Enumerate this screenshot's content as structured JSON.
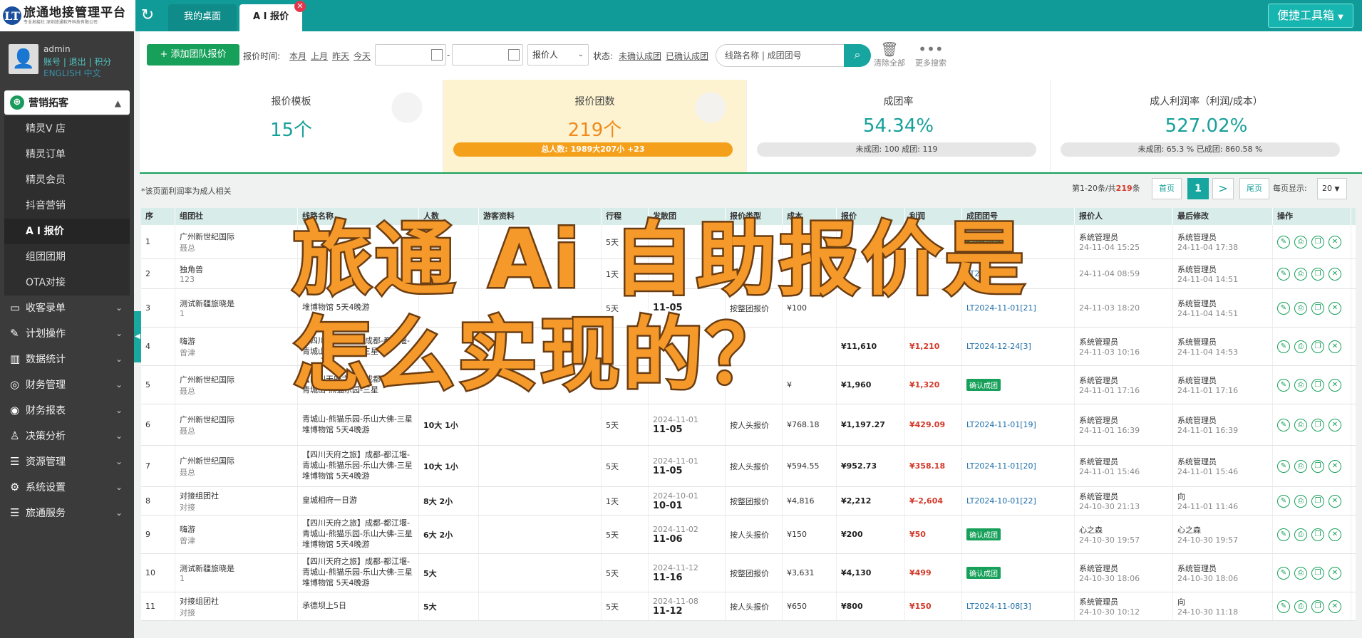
{
  "topbar": {
    "logo_letter": "LT",
    "logo_title": "旅通地接管理平台",
    "logo_sub": "专业地接社 深圳旅通软件科技有限公司",
    "tab_desktop": "我的桌面",
    "tab_ai": "A I 报价",
    "toolbox": "便捷工具箱"
  },
  "user": {
    "name": "admin",
    "links": "账号 | 退出 | 积分",
    "lang": "ENGLISH  中文"
  },
  "sidebar": {
    "section": "营销拓客",
    "subitems": [
      "精灵V 店",
      "精灵订单",
      "精灵会员",
      "抖音营销",
      "A I 报价",
      "组团团期",
      "OTA对接"
    ],
    "items": [
      {
        "label": "收客录单",
        "icon": "monitor-icon"
      },
      {
        "label": "计划操作",
        "icon": "edit-icon"
      },
      {
        "label": "数据统计",
        "icon": "chart-icon"
      },
      {
        "label": "财务管理",
        "icon": "coins-icon"
      },
      {
        "label": "财务报表",
        "icon": "moneybag-icon"
      },
      {
        "label": "决策分析",
        "icon": "user-plus-icon"
      },
      {
        "label": "资源管理",
        "icon": "list-icon"
      },
      {
        "label": "系统设置",
        "icon": "gear-icon"
      },
      {
        "label": "旅通服务",
        "icon": "list-icon"
      }
    ]
  },
  "filters": {
    "add_button": "添加团队报价",
    "time_label": "报价时间:",
    "quick": [
      "本月",
      "上月",
      "昨天",
      "今天"
    ],
    "dash": "-",
    "quoter": "报价人",
    "status_label": "状态:",
    "status_unconfirmed": "未确认成团",
    "status_confirmed": "已确认成团",
    "search_placeholder": "线路名称 | 成团团号",
    "clear_all": "清除全部",
    "more_search": "更多搜索"
  },
  "stats": [
    {
      "title": "报价模板",
      "value": "15个",
      "bar": ""
    },
    {
      "title": "报价团数",
      "value": "219个",
      "bar": "总人数:  1989大207小 +23"
    },
    {
      "title": "成团率",
      "value": "54.34%",
      "bar": "未成团: 100  成团: 119"
    },
    {
      "title": "成人利润率（利润/成本）",
      "value": "527.02%",
      "bar": "未成团: 65.3 %  已成团: 860.58 %"
    }
  ],
  "note": "*该页面利润率为成人相关",
  "pager": {
    "summary_pre": "第1-20条/共",
    "total": "219",
    "summary_post": "条",
    "first": "首页",
    "current": "1",
    "next": ">",
    "last": "尾页",
    "per_page_label": "每页显示:",
    "per_page": "20"
  },
  "columns": [
    "序",
    "组团社",
    "线路名称",
    "人数",
    "游客资料",
    "行程",
    "发散团",
    "报价类型",
    "成本",
    "报价",
    "利润",
    "成团团号",
    "报价人",
    "最后修改",
    "操作"
  ],
  "rows": [
    {
      "no": "1",
      "agency": "广州新世纪国际",
      "contact": "聂总",
      "route": "",
      "people": "",
      "days": "5天",
      "d1": "",
      "d2": "",
      "qtype": "",
      "cost": "",
      "price": "",
      "profit": "",
      "group_no": "",
      "badge": "确认成团",
      "quoter": "系统管理员",
      "qtime": "24-11-04 15:25",
      "editor": "系统管理员",
      "etime": "24-11-04 17:38"
    },
    {
      "no": "2",
      "agency": "独角兽",
      "contact": "123",
      "route": "",
      "people": "",
      "days": "1天",
      "d1": "",
      "d2": "",
      "qtype": "",
      "cost": "",
      "price": "",
      "profit": "",
      "group_no": "LT2024-1",
      "badge": "",
      "quoter": "",
      "qtime": "24-11-04 08:59",
      "editor": "系统管理员",
      "etime": "24-11-04 14:51"
    },
    {
      "no": "3",
      "agency": "测试新疆旅晓是",
      "contact": "1",
      "route": "堆博物馆 5天4晚游",
      "people": "",
      "days": "5天",
      "d1": "",
      "d2": "11-05",
      "qtype": "按整团报价",
      "cost": "¥100",
      "price": "",
      "profit": "",
      "group_no": "LT2024-11-01[21]",
      "badge": "",
      "quoter": "",
      "qtime": "24-11-03 18:20",
      "editor": "系统管理员",
      "etime": "24-11-04 14:51"
    },
    {
      "no": "4",
      "agency": "嗨游",
      "contact": "曾津",
      "route": "【四川天府之旅】成都-都江堰-青城山-熊猫乐园-三星",
      "people": "",
      "days": "",
      "d1": "",
      "d2": "",
      "qtype": "",
      "cost": "",
      "price": "¥11,610",
      "profit": "¥1,210",
      "group_no": "LT2024-12-24[3]",
      "badge": "",
      "quoter": "系统管理员",
      "qtime": "24-11-03 10:16",
      "editor": "系统管理员",
      "etime": "24-11-04 14:53"
    },
    {
      "no": "5",
      "agency": "广州新世纪国际",
      "contact": "聂总",
      "route": "【四川天府之旅】成都-都江堰-青城山-熊猫乐园-三星",
      "people": "",
      "days": "",
      "d1": "",
      "d2": "",
      "qtype": "",
      "cost": "¥",
      "price": "¥1,960",
      "profit": "¥1,320",
      "group_no": "",
      "badge": "确认成团",
      "quoter": "系统管理员",
      "qtime": "24-11-01 17:16",
      "editor": "系统管理员",
      "etime": "24-11-01 17:16"
    },
    {
      "no": "6",
      "agency": "广州新世纪国际",
      "contact": "聂总",
      "route": "青城山-熊猫乐园-乐山大佛-三星堆博物馆 5天4晚游",
      "people": "10大 1小",
      "days": "5天",
      "d1": "2024-11-01",
      "d2": "11-05",
      "qtype": "按人头报价",
      "cost": "¥768.18",
      "price": "¥1,197.27",
      "profit": "¥429.09",
      "group_no": "LT2024-11-01[19]",
      "badge": "",
      "quoter": "系统管理员",
      "qtime": "24-11-01 16:39",
      "editor": "系统管理员",
      "etime": "24-11-01 16:39"
    },
    {
      "no": "7",
      "agency": "广州新世纪国际",
      "contact": "聂总",
      "route": "【四川天府之旅】成都-都江堰-青城山-熊猫乐园-乐山大佛-三星堆博物馆 5天4晚游",
      "people": "10大 1小",
      "days": "5天",
      "d1": "2024-11-01",
      "d2": "11-05",
      "qtype": "按人头报价",
      "cost": "¥594.55",
      "price": "¥952.73",
      "profit": "¥358.18",
      "group_no": "LT2024-11-01[20]",
      "badge": "",
      "quoter": "系统管理员",
      "qtime": "24-11-01 15:46",
      "editor": "系统管理员",
      "etime": "24-11-01 15:46"
    },
    {
      "no": "8",
      "agency": "对接组团社",
      "contact": "对接",
      "route": "皇城相府一日游",
      "people": "8大 2小",
      "days": "1天",
      "d1": "2024-10-01",
      "d2": "10-01",
      "qtype": "按整团报价",
      "cost": "¥4,816",
      "price": "¥2,212",
      "profit": "¥-2,604",
      "group_no": "LT2024-10-01[22]",
      "badge": "",
      "quoter": "系统管理员",
      "qtime": "24-10-30 21:13",
      "editor": "向",
      "etime": "24-11-01 11:46"
    },
    {
      "no": "9",
      "agency": "嗨游",
      "contact": "曾津",
      "route": "【四川天府之旅】成都-都江堰-青城山-熊猫乐园-乐山大佛-三星堆博物馆 5天4晚游",
      "people": "6大 2小",
      "days": "5天",
      "d1": "2024-11-02",
      "d2": "11-06",
      "qtype": "按人头报价",
      "cost": "¥150",
      "price": "¥200",
      "profit": "¥50",
      "group_no": "",
      "badge": "确认成团",
      "quoter": "心之森",
      "qtime": "24-10-30 19:57",
      "editor": "心之森",
      "etime": "24-10-30 19:57"
    },
    {
      "no": "10",
      "agency": "测试新疆旅晓是",
      "contact": "1",
      "route": "【四川天府之旅】成都-都江堰-青城山-熊猫乐园-乐山大佛-三星堆博物馆 5天4晚游",
      "people": "5大",
      "days": "5天",
      "d1": "2024-11-12",
      "d2": "11-16",
      "qtype": "按整团报价",
      "cost": "¥3,631",
      "price": "¥4,130",
      "profit": "¥499",
      "group_no": "",
      "badge": "确认成团",
      "quoter": "系统管理员",
      "qtime": "24-10-30 18:06",
      "editor": "系统管理员",
      "etime": "24-10-30 18:06"
    },
    {
      "no": "11",
      "agency": "对接组团社",
      "contact": "对接",
      "route": "承德坝上5日",
      "people": "5大",
      "days": "5天",
      "d1": "2024-11-08",
      "d2": "11-12",
      "qtype": "按人头报价",
      "cost": "¥650",
      "price": "¥800",
      "profit": "¥150",
      "group_no": "LT2024-11-08[3]",
      "badge": "",
      "quoter": "系统管理员",
      "qtime": "24-10-30 10:12",
      "editor": "向",
      "etime": "24-10-30 11:18"
    }
  ],
  "overlay": {
    "line1": "旅通 Ai 自助报价是",
    "line2": "怎么实现的？"
  },
  "colors": {
    "teal": "#119b98",
    "green": "#17a05a",
    "orange": "#f59a2a",
    "red": "#d43a2a"
  }
}
